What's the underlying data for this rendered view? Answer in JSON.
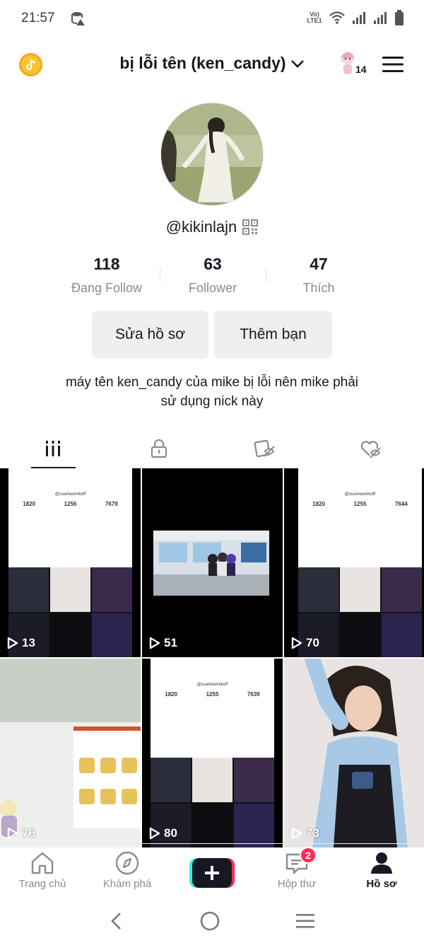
{
  "status_bar": {
    "time": "21:57",
    "network": "VoLTE LTE1"
  },
  "header": {
    "username": "bị lỗi tên (ken_candy)",
    "notification_count": "14"
  },
  "profile": {
    "handle": "@kikinlajn",
    "stats": [
      {
        "value": "118",
        "label": "Đang Follow"
      },
      {
        "value": "63",
        "label": "Follower"
      },
      {
        "value": "47",
        "label": "Thích"
      }
    ],
    "edit_button": "Sửa hồ sơ",
    "add_friend_button": "Thêm bạn",
    "bio_line1": "máy tên ken_candy của mike bị lỗi nên mike phải",
    "bio_line2": "sử dụng nick này"
  },
  "videos": [
    {
      "views": "13",
      "mini_user": "@suameomikoff",
      "mini_stats": [
        "1820",
        "1256",
        "7679"
      ]
    },
    {
      "views": "51"
    },
    {
      "views": "70",
      "mini_user": "@suameomikoff",
      "mini_stats": [
        "1820",
        "1255",
        "7644"
      ]
    },
    {
      "views": "76"
    },
    {
      "views": "80",
      "mini_user": "@suameomikoff",
      "mini_stats": [
        "1820",
        "1255",
        "7639"
      ]
    },
    {
      "views": "73"
    }
  ],
  "bottom_nav": {
    "home": "Trang chủ",
    "discover": "Khám phá",
    "inbox": "Hộp thư",
    "inbox_badge": "2",
    "profile": "Hồ sơ"
  },
  "colors": {
    "accent": "#fe2c55",
    "cyan": "#25f4ee",
    "text": "#161823",
    "muted": "#8a8b91"
  }
}
